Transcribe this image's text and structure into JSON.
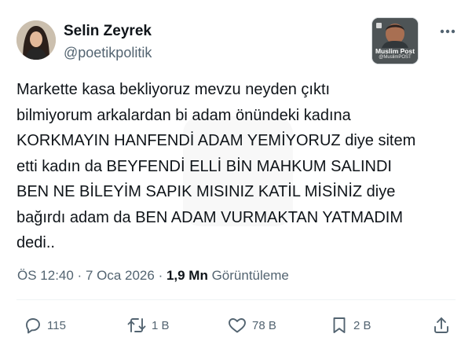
{
  "author": {
    "display_name": "Selin Zeyrek",
    "handle": "@poetikpolitik"
  },
  "badge": {
    "title": "Muslim Post",
    "subtitle": "@MuslimPOST"
  },
  "tweet": {
    "lines": [
      "Markette kasa bekliyoruz mevzu neyden çıktı",
      "bilmiyorum arkalardan bi adam önündeki kadına",
      "KORKMAYIN HANFENDİ ADAM YEMİYORUZ diye sitem",
      "etti kadın da BEYFENDİ ELLİ BİN MAHKUM SALINDI",
      "BEN NE BİLEYİM SAPIK MISINIZ KATİL MİSİNİZ diye",
      "bağırdı adam da BEN ADAM VURMAKTAN YATMADIM",
      "dedi.."
    ]
  },
  "meta": {
    "time": "ÖS 12:40",
    "separator": " · ",
    "date": "7 Oca 2026",
    "separator2": " · ",
    "views_count": "1,9 Mn",
    "views_label": " Görüntüleme"
  },
  "actions": {
    "replies": "115",
    "reposts": "1 B",
    "likes": "78 B",
    "bookmarks": "2 B"
  },
  "icons": {
    "more": "more-horizontal-icon",
    "reply": "reply-icon",
    "repost": "repost-icon",
    "like": "heart-icon",
    "bookmark": "bookmark-icon",
    "share": "share-icon"
  },
  "colors": {
    "text": "#0f1419",
    "secondary": "#536471",
    "divider": "#eff3f4"
  }
}
